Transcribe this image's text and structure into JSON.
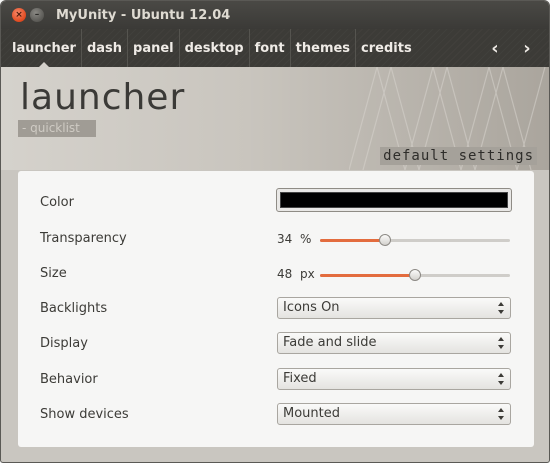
{
  "window": {
    "title": "MyUnity - Ubuntu 12.04",
    "close_glyph": "×",
    "minimize_glyph": "–"
  },
  "nav": {
    "items": [
      {
        "label": "launcher",
        "active": true
      },
      {
        "label": "dash"
      },
      {
        "label": "panel"
      },
      {
        "label": "desktop"
      },
      {
        "label": "font"
      },
      {
        "label": "themes"
      },
      {
        "label": "credits"
      }
    ],
    "prev_glyph": "‹",
    "next_glyph": "›"
  },
  "banner": {
    "title": "launcher",
    "subtitle": "- quicklist",
    "default_settings": "default settings"
  },
  "settings": {
    "color": {
      "label": "Color",
      "value": "#000000"
    },
    "transparency": {
      "label": "Transparency",
      "value": "34",
      "unit": "%",
      "fraction": 0.34
    },
    "size": {
      "label": "Size",
      "value": "48",
      "unit": "px",
      "fraction": 0.5
    },
    "backlights": {
      "label": "Backlights",
      "selected": "Icons On"
    },
    "display": {
      "label": "Display",
      "selected": "Fade and slide"
    },
    "behavior": {
      "label": "Behavior",
      "selected": "Fixed"
    },
    "show_devices": {
      "label": "Show devices",
      "selected": "Mounted"
    }
  },
  "icons": {
    "close": "close-icon",
    "minimize": "minimize-icon",
    "prev": "chevron-left-icon",
    "next": "chevron-right-icon",
    "combo": "up-down-arrows-icon"
  },
  "colors": {
    "accent": "#e36c3e",
    "titlebar": "#3c3b37",
    "close_button": "#e0491f"
  }
}
